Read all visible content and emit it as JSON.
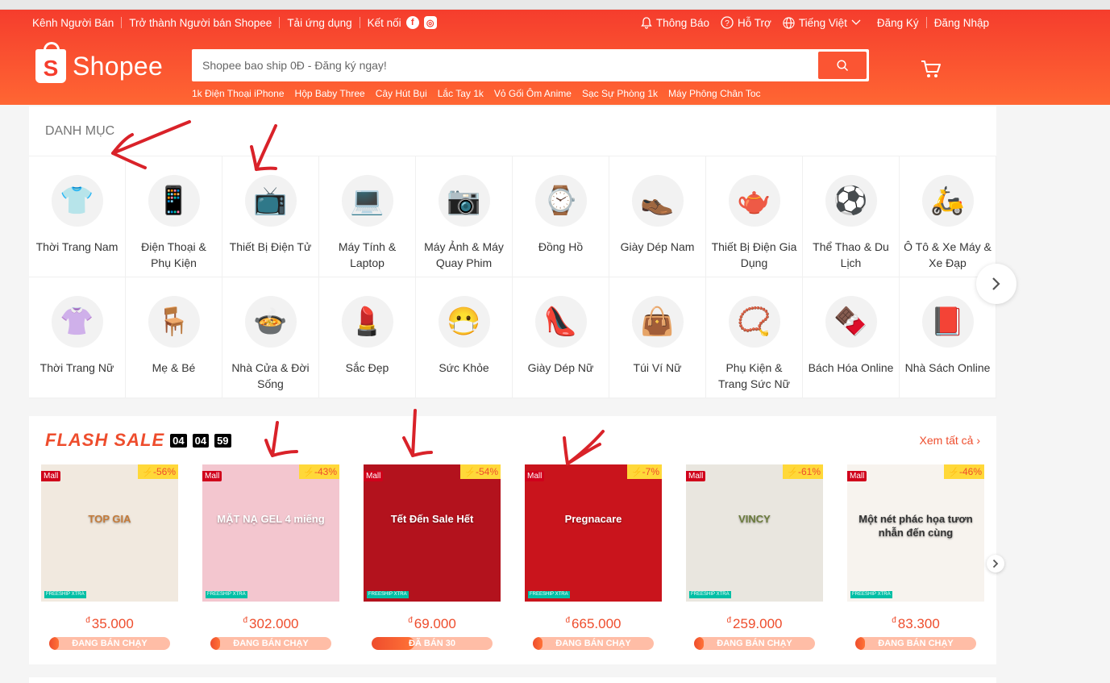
{
  "header": {
    "nav_left": [
      "Kênh Người Bán",
      "Trở thành Người bán Shopee",
      "Tải ứng dụng",
      "Kết nối"
    ],
    "nav_right": {
      "notifications": "Thông Báo",
      "support": "Hỗ Trợ",
      "language": "Tiếng Việt",
      "register": "Đăng Ký",
      "login": "Đăng Nhập"
    },
    "logo_text": "Shopee",
    "search_placeholder": "Shopee bao ship 0Đ - Đăng ký ngay!",
    "suggestions": [
      "1k Điện Thoại iPhone",
      "Hộp Baby Three",
      "Cây Hút Bụi",
      "Lắc Tay 1k",
      "Vỏ Gối Ôm Anime",
      "Sạc Sự Phòng 1k",
      "Máy Phông Chân Toc"
    ]
  },
  "categories": {
    "title": "DANH MỤC",
    "items": [
      {
        "label": "Thời Trang Nam",
        "icon": "👕",
        "icon_name": "shirt-icon"
      },
      {
        "label": "Điện Thoại & Phụ Kiện",
        "icon": "📱",
        "icon_name": "phone-icon"
      },
      {
        "label": "Thiết Bị Điện Tử",
        "icon": "📺",
        "icon_name": "tv-icon"
      },
      {
        "label": "Máy Tính & Laptop",
        "icon": "💻",
        "icon_name": "laptop-icon"
      },
      {
        "label": "Máy Ảnh & Máy Quay Phim",
        "icon": "📷",
        "icon_name": "camera-icon"
      },
      {
        "label": "Đồng Hồ",
        "icon": "⌚",
        "icon_name": "watch-icon"
      },
      {
        "label": "Giày Dép Nam",
        "icon": "👞",
        "icon_name": "shoe-icon"
      },
      {
        "label": "Thiết Bị Điện Gia Dụng",
        "icon": "🫖",
        "icon_name": "kettle-icon"
      },
      {
        "label": "Thể Thao & Du Lịch",
        "icon": "⚽",
        "icon_name": "ball-icon"
      },
      {
        "label": "Ô Tô & Xe Máy & Xe Đạp",
        "icon": "🛵",
        "icon_name": "scooter-icon"
      },
      {
        "label": "Thời Trang Nữ",
        "icon": "👚",
        "icon_name": "top-icon"
      },
      {
        "label": "Mẹ & Bé",
        "icon": "🪑",
        "icon_name": "highchair-icon"
      },
      {
        "label": "Nhà Cửa & Đời Sống",
        "icon": "🍲",
        "icon_name": "pot-icon"
      },
      {
        "label": "Sắc Đẹp",
        "icon": "💄",
        "icon_name": "lipstick-icon"
      },
      {
        "label": "Sức Khỏe",
        "icon": "😷",
        "icon_name": "mask-icon"
      },
      {
        "label": "Giày Dép Nữ",
        "icon": "👠",
        "icon_name": "heel-icon"
      },
      {
        "label": "Túi Ví Nữ",
        "icon": "👜",
        "icon_name": "handbag-icon"
      },
      {
        "label": "Phụ Kiện & Trang Sức Nữ",
        "icon": "📿",
        "icon_name": "bracelet-icon"
      },
      {
        "label": "Bách Hóa Online",
        "icon": "🍫",
        "icon_name": "chocolate-icon"
      },
      {
        "label": "Nhà Sách Online",
        "icon": "📕",
        "icon_name": "book-icon"
      }
    ]
  },
  "flash_sale": {
    "title": "FLASH SALE",
    "timer": [
      "04",
      "04",
      "59"
    ],
    "see_all": "Xem tất cả",
    "products": [
      {
        "price": "35.000",
        "discount": "-56%",
        "status": "ĐANG BÁN CHẠY",
        "sold_fraction": 0.08,
        "bg": "#f1e9df",
        "caption": "TOP GIA",
        "text_color": "#c47b3a"
      },
      {
        "price": "302.000",
        "discount": "-43%",
        "status": "ĐANG BÁN CHẠY",
        "sold_fraction": 0.08,
        "bg": "#f3c6cf",
        "caption": "MẶT NẠ GEL 4 miếng",
        "text_color": "#ffffff"
      },
      {
        "price": "69.000",
        "discount": "-54%",
        "status": "ĐÃ BÁN 30",
        "sold_fraction": 0.35,
        "bg": "#b3121d",
        "caption": "Tết Đến Sale Hết",
        "text_color": "#ffffff"
      },
      {
        "price": "665.000",
        "discount": "-7%",
        "status": "ĐANG BÁN CHẠY",
        "sold_fraction": 0.08,
        "bg": "#c9141c",
        "caption": "Pregnacare",
        "text_color": "#ffffff"
      },
      {
        "price": "259.000",
        "discount": "-61%",
        "status": "ĐANG BÁN CHẠY",
        "sold_fraction": 0.08,
        "bg": "#e9e6df",
        "caption": "VINCY",
        "text_color": "#6b7b3c"
      },
      {
        "price": "83.300",
        "discount": "-46%",
        "status": "ĐANG BÁN CHẠY",
        "sold_fraction": 0.08,
        "bg": "#f7f3ee",
        "caption": "Một nét phác họa tươn nhẫn đến cùng",
        "text_color": "#333333"
      }
    ],
    "labels": {
      "mall": "Mall",
      "freeship": "FREESHIP XTRA",
      "currency": "đ"
    }
  }
}
